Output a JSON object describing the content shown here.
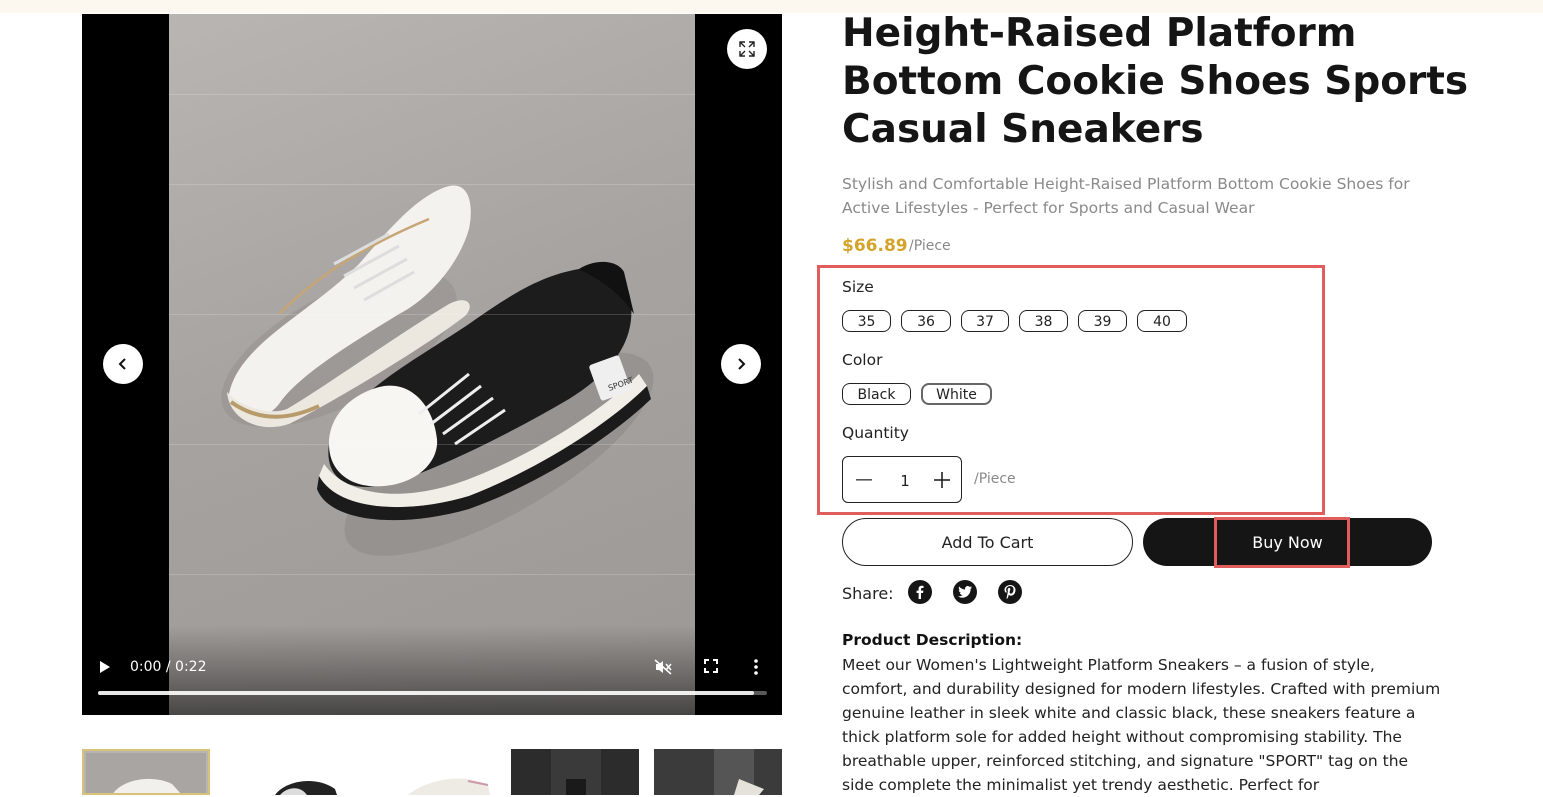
{
  "product": {
    "title": "Height-Raised Platform Bottom Cookie Shoes Sports Casual Sneakers",
    "subtitle": "Stylish and Comfortable Height-Raised Platform Bottom Cookie Shoes for Active Lifestyles - Perfect for Sports and Casual Wear",
    "price": "$66.89",
    "price_unit": "/Piece"
  },
  "video": {
    "time": "0:00 / 0:22",
    "progress": 0.98,
    "shoe_tag": "SPORT"
  },
  "options": {
    "size_label": "Size",
    "sizes": [
      "35",
      "36",
      "37",
      "38",
      "39",
      "40"
    ],
    "color_label": "Color",
    "colors": [
      "Black",
      "White"
    ],
    "selected_color": "White",
    "quantity_label": "Quantity",
    "quantity": "1",
    "quantity_unit": "/Piece"
  },
  "actions": {
    "add_to_cart": "Add To Cart",
    "buy_now": "Buy Now"
  },
  "share": {
    "label": "Share:",
    "icons": [
      "facebook-icon",
      "twitter-icon",
      "pinterest-icon"
    ]
  },
  "description": {
    "title": "Product Description:",
    "text": "Meet our Women's Lightweight Platform Sneakers – a fusion of style, comfort, and durability designed for modern lifestyles. Crafted with premium genuine leather in sleek white and classic black, these sneakers feature a thick platform sole for added height without compromising stability. The breathable upper, reinforced stitching, and signature \"SPORT\" tag on the side complete the minimalist yet trendy aesthetic. Perfect for"
  },
  "colors": {
    "accent_price": "#d4a32a",
    "highlight_box": "#e05d5d",
    "buy_button": "#151515"
  }
}
